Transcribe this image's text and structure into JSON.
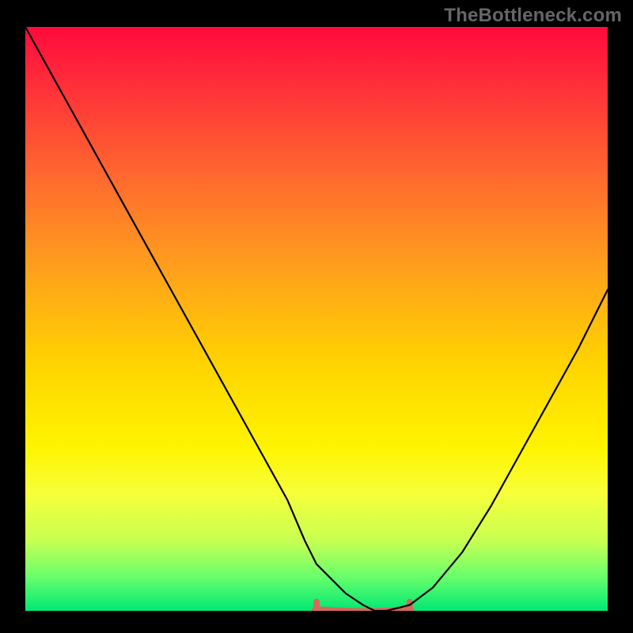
{
  "watermark": "TheBottleneck.com",
  "chart_data": {
    "type": "line",
    "title": "",
    "xlabel": "",
    "ylabel": "",
    "xlim": [
      0,
      100
    ],
    "ylim": [
      0,
      100
    ],
    "grid": false,
    "legend": false,
    "annotations": [],
    "background_gradient": {
      "direction": "vertical",
      "stops": [
        {
          "pos": 0.0,
          "color": "#ff0a3c"
        },
        {
          "pos": 0.1,
          "color": "#ff2f3a"
        },
        {
          "pos": 0.26,
          "color": "#ff6a2e"
        },
        {
          "pos": 0.42,
          "color": "#ffa21b"
        },
        {
          "pos": 0.58,
          "color": "#ffd400"
        },
        {
          "pos": 0.72,
          "color": "#fff400"
        },
        {
          "pos": 0.8,
          "color": "#f6ff3a"
        },
        {
          "pos": 0.88,
          "color": "#c7ff52"
        },
        {
          "pos": 0.94,
          "color": "#6bff6b"
        },
        {
          "pos": 1.0,
          "color": "#00e874"
        }
      ]
    },
    "series": [
      {
        "name": "curve",
        "color": "#000000",
        "x": [
          0,
          5,
          10,
          15,
          20,
          25,
          30,
          35,
          40,
          45,
          48,
          50,
          55,
          58,
          60,
          62,
          66,
          70,
          75,
          80,
          85,
          90,
          95,
          100
        ],
        "y": [
          100,
          91,
          82,
          73,
          64,
          55,
          46,
          37,
          28,
          19,
          12,
          8,
          3,
          1,
          0,
          0,
          1,
          4,
          10,
          18,
          27,
          36,
          45,
          55
        ]
      }
    ],
    "highlight_band": {
      "name": "bottom-band",
      "color": "#d46a5a",
      "x_start": 50,
      "x_end": 66,
      "y": 0,
      "tick_height": 1.5
    }
  }
}
